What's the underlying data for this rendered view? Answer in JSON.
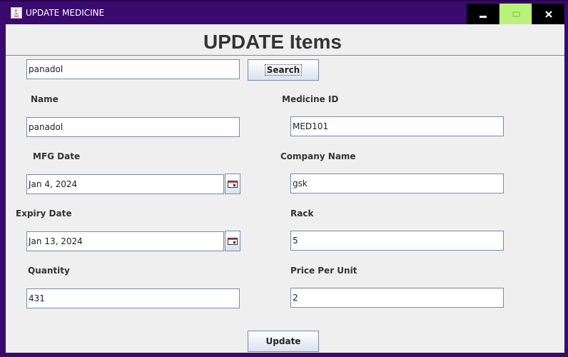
{
  "window": {
    "title": "UPDATE MEDICINE",
    "controls": {
      "minimize": "minimize-icon",
      "maximize": "maximize-icon",
      "close": "close-icon"
    },
    "colors": {
      "titlebar": "#3a0a6e",
      "maximize_bg": "#b8f27a"
    }
  },
  "form": {
    "heading": "UPDATE Items",
    "search": {
      "value": "panadol",
      "button_label": "Search"
    },
    "labels": {
      "name": "Name",
      "medicine_id": "Medicine ID",
      "mfg_date": "MFG Date",
      "company_name": "Company Name",
      "expiry_date": "Expiry Date",
      "rack": "Rack",
      "quantity": "Quantity",
      "price_per_unit": "Price Per Unit"
    },
    "values": {
      "name": "panadol",
      "medicine_id": "MED101",
      "mfg_date": "Jan 4, 2024",
      "company_name": "gsk",
      "expiry_date": "Jan 13, 2024",
      "rack": "5",
      "quantity": "431",
      "price_per_unit": "2"
    },
    "update_label": "Update"
  }
}
